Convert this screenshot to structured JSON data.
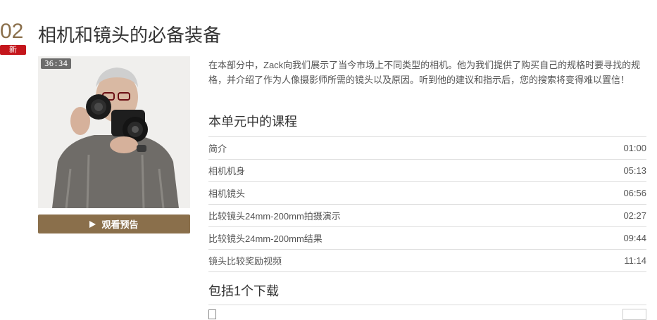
{
  "unit": {
    "number": "02",
    "badge": "新",
    "title": "相机和镜头的必备装备",
    "duration": "36:34",
    "preview_label": "观看预告",
    "description": "在本部分中，Zack向我们展示了当今市场上不同类型的相机。他为我们提供了购买自己的规格时要寻找的规格，并介绍了作为人像摄影师所需的镜头以及原因。听到他的建议和指示后，您的搜索将变得难以置信！"
  },
  "lessons_section": {
    "title": "本单元中的课程",
    "items": [
      {
        "title": "简介",
        "time": "01:00"
      },
      {
        "title": "相机机身",
        "time": "05:13"
      },
      {
        "title": "相机镜头",
        "time": "06:56"
      },
      {
        "title": "比较镜头24mm-200mm拍摄演示",
        "time": "02:27"
      },
      {
        "title": "比较镜头24mm-200mm结果",
        "time": "09:44"
      },
      {
        "title": "镜头比较奖励视频",
        "time": "11:14"
      }
    ]
  },
  "downloads_section": {
    "title": "包括1个下载"
  },
  "colors": {
    "accent": "#8a6f4b",
    "badge": "#c4161c"
  }
}
